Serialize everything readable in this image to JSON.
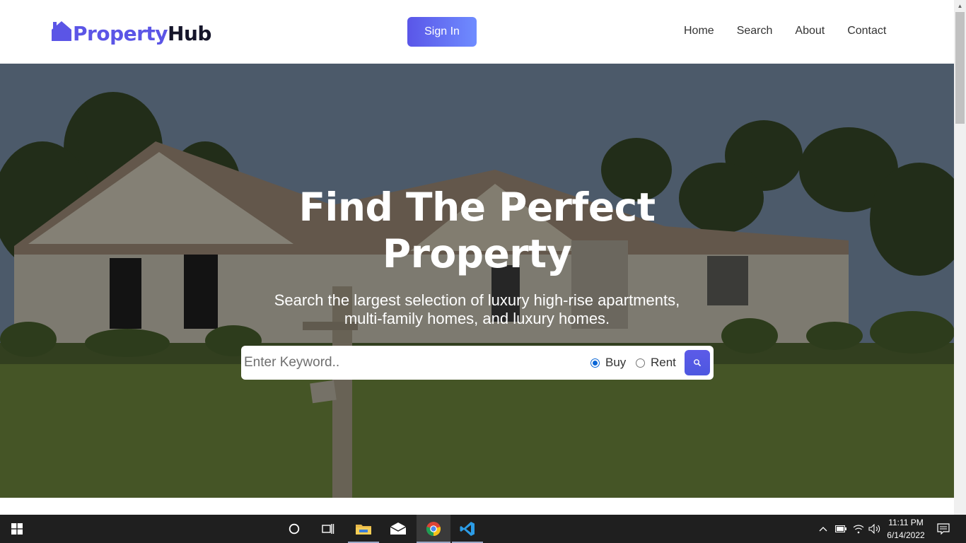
{
  "navbar": {
    "logo_part1": "Property",
    "logo_part2": "Hub",
    "sign_in_label": "Sign In",
    "links": [
      "Home",
      "Search",
      "About",
      "Contact"
    ]
  },
  "hero": {
    "title_line1": "Find The Perfect",
    "title_line2": "Property",
    "subtitle_line1": "Search the largest selection of luxury high-rise apartments,",
    "subtitle_line2": "multi-family homes, and luxury homes."
  },
  "search": {
    "placeholder": "Enter Keyword..",
    "value": "",
    "options": [
      "Buy",
      "Rent"
    ],
    "selected": "Buy"
  },
  "taskbar": {
    "time": "11:11 PM",
    "date": "6/14/2022",
    "apps": [
      "start-icon",
      "cortana-icon",
      "task-view-icon",
      "file-explorer-icon",
      "mail-icon",
      "chrome-icon",
      "vscode-icon"
    ]
  },
  "colors": {
    "brand": "#5b55e6",
    "brand_dark": "#15152a",
    "button_gradient_start": "#5a56e8",
    "button_gradient_end": "#6f8cff"
  }
}
